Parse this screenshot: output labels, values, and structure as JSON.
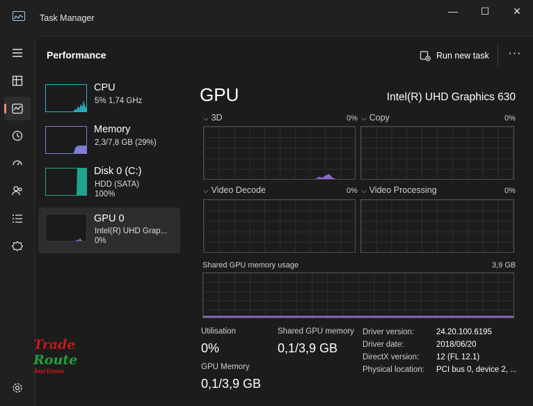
{
  "window": {
    "title": "Task Manager",
    "minimize_glyph": "—",
    "maximize_glyph": "☐",
    "close_glyph": "✕"
  },
  "nav": {
    "items": [
      {
        "icon": "hamburger-menu-icon"
      },
      {
        "icon": "processes-icon"
      },
      {
        "icon": "performance-icon",
        "active": true
      },
      {
        "icon": "app-history-icon"
      },
      {
        "icon": "startup-apps-icon"
      },
      {
        "icon": "users-icon"
      },
      {
        "icon": "details-icon"
      },
      {
        "icon": "services-icon"
      },
      {
        "icon": "settings-icon"
      }
    ]
  },
  "header": {
    "title": "Performance",
    "run_new_task": "Run new task",
    "more": "···"
  },
  "devices": [
    {
      "name": "CPU",
      "line1": "5%  1,74 GHz",
      "line2": "",
      "color": "#2bb5c8",
      "usage": 0.05
    },
    {
      "name": "Memory",
      "line1": "2,3/7,8 GB (29%)",
      "line2": "",
      "color": "#7b7fd6",
      "usage": 0.29
    },
    {
      "name": "Disk 0 (C:)",
      "line1": "HDD (SATA)",
      "line2": "100%",
      "color": "#1fa38a",
      "usage": 1.0
    },
    {
      "name": "GPU 0",
      "line1": "Intel(R) UHD Grap...",
      "line2": "0%",
      "color": "#8e66c9",
      "usage": 0.0,
      "selected": true
    }
  ],
  "gpu": {
    "title": "GPU",
    "model": "Intel(R) UHD Graphics 630",
    "graphs": [
      {
        "label": "3D",
        "pct": "0%"
      },
      {
        "label": "Copy",
        "pct": "0%"
      },
      {
        "label": "Video Decode",
        "pct": "0%"
      },
      {
        "label": "Video Processing",
        "pct": "0%"
      }
    ],
    "shared_memory_graph": {
      "label": "Shared GPU memory usage",
      "max": "3,9 GB"
    },
    "stats": {
      "utilisation_label": "Utilisation",
      "utilisation_value": "0%",
      "shared_label": "Shared GPU memory",
      "shared_value": "0,1/3,9 GB",
      "gpu_memory_label": "GPU Memory",
      "gpu_memory_value": "0,1/3,9 GB"
    },
    "details": [
      {
        "label": "Driver version:",
        "value": "24.20.100.6195"
      },
      {
        "label": "Driver date:",
        "value": "2018/06/20"
      },
      {
        "label": "DirectX version:",
        "value": "12 (FL 12.1)"
      },
      {
        "label": "Physical location:",
        "value": "PCI bus 0, device 2, ..."
      }
    ]
  },
  "watermark": {
    "line1": "Trade",
    "line2": "Route",
    "line3": "Auctions"
  },
  "colors": {
    "accent": "#f28b7f",
    "gpu": "#8e66c9",
    "background": "#202020"
  }
}
